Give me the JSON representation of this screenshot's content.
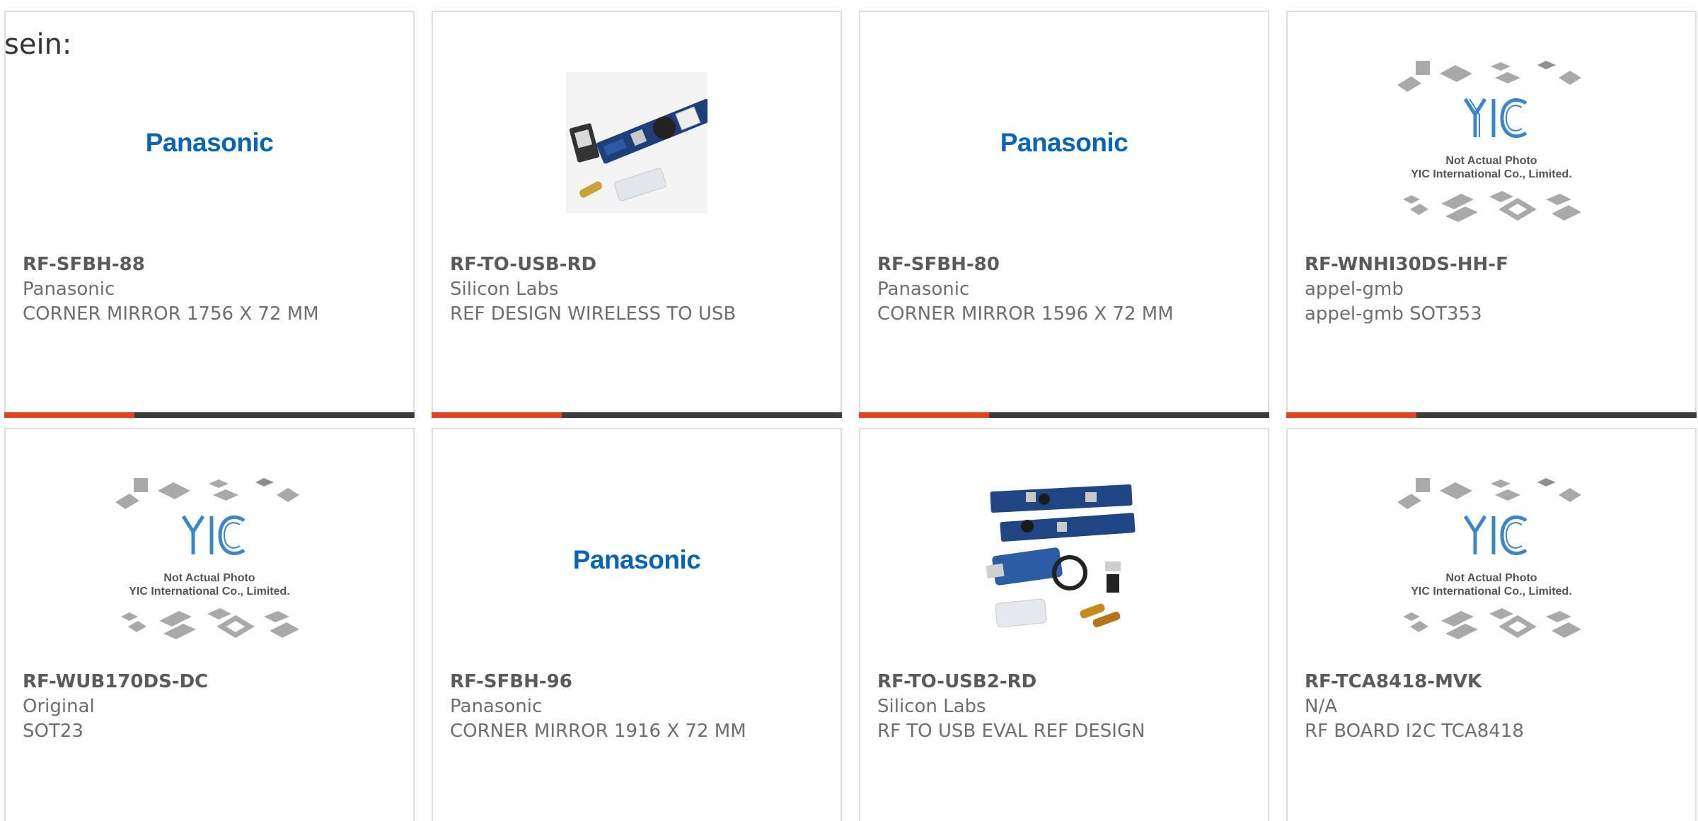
{
  "page": {
    "prefix_text": "sein:"
  },
  "placeholder": {
    "logo_text": "YIC",
    "line1": "Not Actual Photo",
    "line2": "YIC International Co., Limited."
  },
  "brand_logo": {
    "text": "Panasonic"
  },
  "colors": {
    "accent": "#e8411b",
    "bar": "#3d3d3d",
    "panasonic_blue": "#0a63b3"
  },
  "cards": [
    {
      "part": "RF-SFBH-88",
      "manufacturer": "Panasonic",
      "description": "CORNER MIRROR 1756 X 72 MM",
      "image": "panasonic-logo"
    },
    {
      "part": "RF-TO-USB-RD",
      "manufacturer": "Silicon Labs",
      "description": "REF DESIGN WIRELESS TO USB",
      "image": "product-photo-usb-kit"
    },
    {
      "part": "RF-SFBH-80",
      "manufacturer": "Panasonic",
      "description": "CORNER MIRROR 1596 X 72 MM",
      "image": "panasonic-logo"
    },
    {
      "part": "RF-WNHI30DS-HH-F",
      "manufacturer": "appel-gmb",
      "description": "appel-gmb SOT353",
      "image": "yic-placeholder"
    },
    {
      "part": "RF-WUB170DS-DC",
      "manufacturer": "Original",
      "description": "SOT23",
      "image": "yic-placeholder"
    },
    {
      "part": "RF-SFBH-96",
      "manufacturer": "Panasonic",
      "description": "CORNER MIRROR 1916 X 72 MM",
      "image": "panasonic-logo"
    },
    {
      "part": "RF-TO-USB2-RD",
      "manufacturer": "Silicon Labs",
      "description": "RF TO USB EVAL REF DESIGN",
      "image": "product-photo-usb-kit-2"
    },
    {
      "part": "RF-TCA8418-MVK",
      "manufacturer": "N/A",
      "description": "RF BOARD I2C TCA8418",
      "image": "yic-placeholder"
    }
  ]
}
